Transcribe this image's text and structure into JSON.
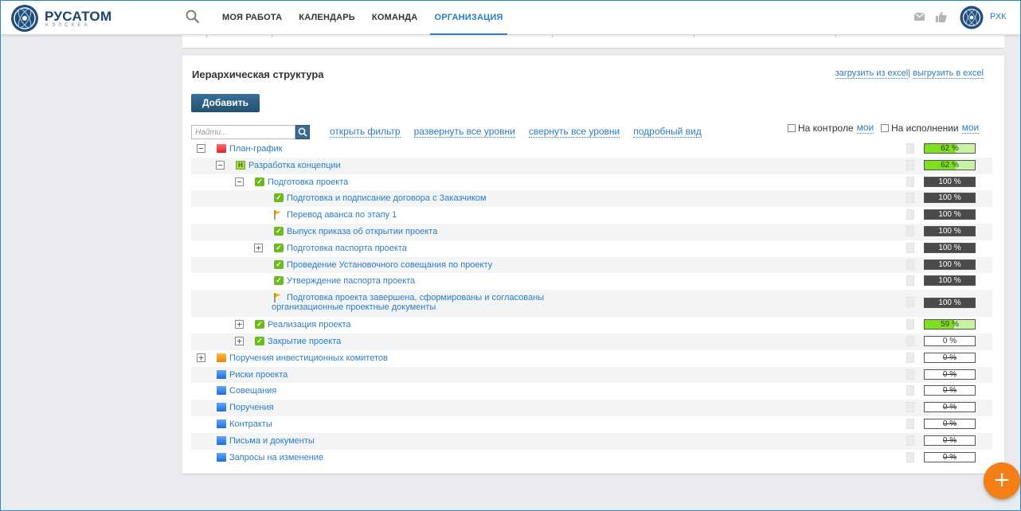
{
  "header": {
    "brand": "РУСАТОМ",
    "brand_sub": "КЭЛСКЕА",
    "nav": [
      {
        "label": "МОЯ РАБОТА",
        "active": false
      },
      {
        "label": "КАЛЕНДАРЬ",
        "active": false
      },
      {
        "label": "КОМАНДА",
        "active": false
      },
      {
        "label": "ОРГАНИЗАЦИЯ",
        "active": true
      }
    ],
    "user": "РХК"
  },
  "structure": {
    "title": "Иерархическая структура",
    "import_excel": "загрузить из excel",
    "separator": "|",
    "export_excel": "выгрузить в excel",
    "add_button": "Добавить",
    "search_placeholder": "Найти...",
    "links": [
      "открыть фильтр",
      "развернуть все уровни",
      "свернуть все уровни",
      "подробный вид"
    ],
    "on_control_label": "На контроле",
    "on_control_mine": "мои",
    "in_progress_label": "На исполнении",
    "in_progress_mine": "мои"
  },
  "tree": [
    {
      "label": "План-график",
      "level": 0,
      "toggle": "minus",
      "icon": "folder-red",
      "percent": "62 %",
      "progress": 62,
      "bar": "green"
    },
    {
      "label": "Разработка концепции",
      "level": 1,
      "toggle": "minus",
      "icon": "h-box",
      "percent": "62 %",
      "progress": 62,
      "bar": "green"
    },
    {
      "label": "Подготовка проекта",
      "level": 2,
      "toggle": "minus",
      "icon": "check",
      "percent": "100 %",
      "progress": 100,
      "bar": "dark"
    },
    {
      "label": "Подготовка и подписание договора с Заказчиком",
      "level": 3,
      "toggle": "none",
      "icon": "check",
      "percent": "100 %",
      "progress": 100,
      "bar": "dark"
    },
    {
      "label": "Перевод аванса по этапу 1",
      "level": 3,
      "toggle": "none",
      "icon": "flag",
      "percent": "100 %",
      "progress": 100,
      "bar": "dark"
    },
    {
      "label": "Выпуск приказа об открытии проекта",
      "level": 3,
      "toggle": "none",
      "icon": "check",
      "percent": "100 %",
      "progress": 100,
      "bar": "dark"
    },
    {
      "label": "Подготовка паспорта проекта",
      "level": 3,
      "toggle": "plus",
      "icon": "check",
      "percent": "100 %",
      "progress": 100,
      "bar": "dark"
    },
    {
      "label": "Проведение Установочного совещания по проекту",
      "level": 3,
      "toggle": "none",
      "icon": "check",
      "percent": "100 %",
      "progress": 100,
      "bar": "dark"
    },
    {
      "label": "Утверждение паспорта проекта",
      "level": 3,
      "toggle": "none",
      "icon": "check",
      "percent": "100 %",
      "progress": 100,
      "bar": "dark"
    },
    {
      "label": "Подготовка проекта завершена, сформированы и согласованы организационные проектные документы",
      "level": 3,
      "toggle": "none",
      "icon": "flag",
      "percent": "100 %",
      "progress": 100,
      "bar": "dark",
      "tall": true
    },
    {
      "label": "Реализация проекта",
      "level": 2,
      "toggle": "plus",
      "icon": "check",
      "percent": "59 %",
      "progress": 59,
      "bar": "green"
    },
    {
      "label": "Закрытие проекта",
      "level": 2,
      "toggle": "plus",
      "icon": "check",
      "percent": "0 %",
      "progress": 0,
      "bar": "empty"
    },
    {
      "label": "Поручения инвестиционных комитетов",
      "level": 0,
      "toggle": "plus",
      "icon": "folder-orange",
      "percent": "0 %",
      "progress": 0,
      "bar": "zero"
    },
    {
      "label": "Риски проекта",
      "level": 0,
      "toggle": "none",
      "icon": "folder-blue",
      "percent": "0 %",
      "progress": 0,
      "bar": "zero"
    },
    {
      "label": "Совещания",
      "level": 0,
      "toggle": "none",
      "icon": "folder-blue",
      "percent": "0 %",
      "progress": 0,
      "bar": "zero"
    },
    {
      "label": "Поручения",
      "level": 0,
      "toggle": "none",
      "icon": "folder-blue",
      "percent": "0 %",
      "progress": 0,
      "bar": "zero"
    },
    {
      "label": "Контракты",
      "level": 0,
      "toggle": "none",
      "icon": "folder-blue",
      "percent": "0 %",
      "progress": 0,
      "bar": "zero"
    },
    {
      "label": "Письма и документы",
      "level": 0,
      "toggle": "none",
      "icon": "folder-blue",
      "percent": "0 %",
      "progress": 0,
      "bar": "zero"
    },
    {
      "label": "Запросы на изменение",
      "level": 0,
      "toggle": "none",
      "icon": "folder-blue",
      "percent": "0 %",
      "progress": 0,
      "bar": "zero"
    }
  ],
  "colors": {
    "accent": "#2b7dc3",
    "progress_green": "#7ee021",
    "progress_green_bg": "#c8f3a2",
    "progress_dark": "#4a4a4a",
    "fab": "#f57f17"
  },
  "fab_icon": "plus-icon"
}
